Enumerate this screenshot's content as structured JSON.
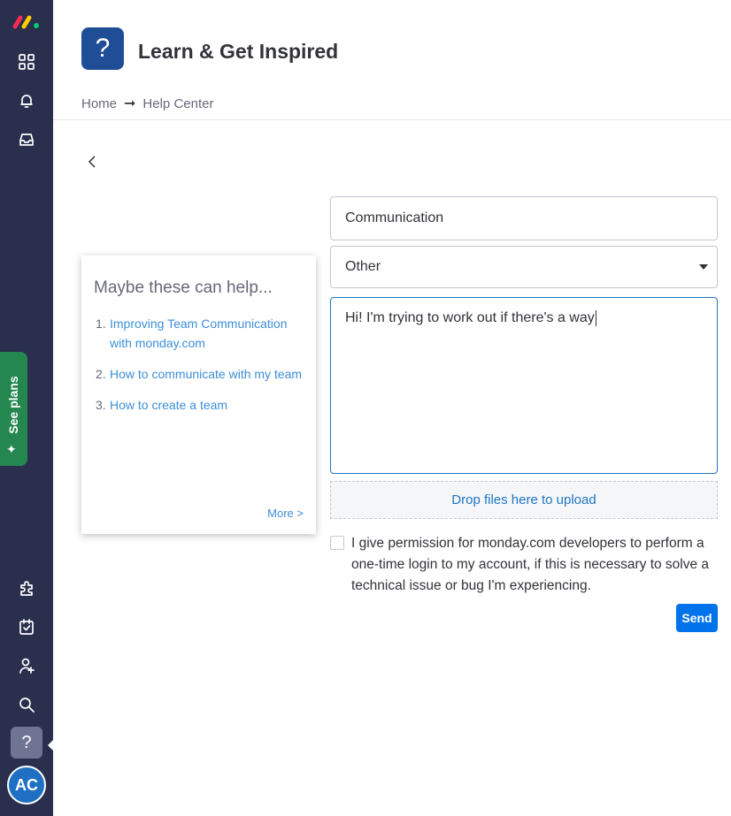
{
  "sidebar": {
    "icons": [
      "monday-logo",
      "apps-grid-icon",
      "bell-icon",
      "inbox-icon",
      "puzzle-icon",
      "calendar-check-icon",
      "add-user-icon",
      "search-icon",
      "help-icon"
    ],
    "see_plans_label": "See plans",
    "help_glyph": "?",
    "avatar_initials": "AC"
  },
  "header": {
    "icon_glyph": "?",
    "title": "Learn & Get Inspired",
    "breadcrumb": {
      "home": "Home",
      "separator": "➞",
      "current": "Help Center"
    }
  },
  "suggestions": {
    "title": "Maybe these can help...",
    "items": [
      {
        "num": "1.",
        "label": "Improving Team Communication with monday.com"
      },
      {
        "num": "2.",
        "label": "How to communicate with my team"
      },
      {
        "num": "3.",
        "label": "How to create a team"
      }
    ],
    "more_label": "More >"
  },
  "form": {
    "subject_value": "Communication",
    "category_value": "Other",
    "message_value": "Hi! I'm trying to work out if there's a way",
    "dropzone_label": "Drop files here to upload",
    "permission_text": "I give permission for monday.com developers to perform a one-time login to my account, if this is necessary to solve a technical issue or bug I'm experiencing.",
    "permission_checked": false,
    "send_label": "Send"
  },
  "colors": {
    "sidebar_bg": "#292f4c",
    "accent": "#0073ea",
    "link": "#3d8ed8",
    "see_plans_bg": "#258750",
    "header_icon_bg": "#1f4e96"
  }
}
